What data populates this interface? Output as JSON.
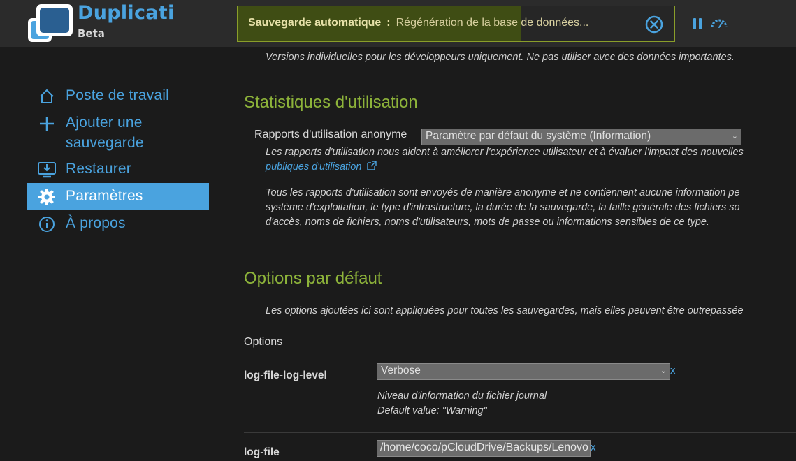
{
  "app": {
    "name": "Duplicati",
    "edition": "Beta"
  },
  "status": {
    "title": "Sauvegarde automatique",
    "separator": ":",
    "message": "Régénération de la base de données...",
    "progress": 0.65
  },
  "colors": {
    "accent": "#4aa3df",
    "heading": "#8db33a",
    "progress": "#3f4d14"
  },
  "sidebar": {
    "items": [
      {
        "label": "Poste de travail",
        "icon": "home-icon"
      },
      {
        "label": "Ajouter une sauvegarde",
        "icon": "plus-icon"
      },
      {
        "label": "Restaurer",
        "icon": "restore-icon"
      },
      {
        "label": "Paramètres",
        "icon": "gear-icon",
        "active": true
      },
      {
        "label": "À propos",
        "icon": "info-icon"
      }
    ]
  },
  "main": {
    "dev_note": "Versions individuelles pour les développeurs uniquement. Ne pas utiliser avec des données importantes.",
    "usage_stats": {
      "heading": "Statistiques d'utilisation",
      "label": "Rapports d'utilisation anonyme",
      "select_value": "Paramètre par défaut du système (Information)",
      "desc1": "Les rapports d'utilisation nous aident à améliorer l'expérience utilisateur et à évaluer l'impact des nouvelles",
      "link": "publiques d'utilisation",
      "desc2_l1": "Tous les rapports d'utilisation sont envoyés de manière anonyme et ne contiennent aucune information pe",
      "desc2_l2": "système d'exploitation, le type d'infrastructure, la durée de la sauvegarde, la taille générale des fichiers so",
      "desc2_l3": "d'accès, noms de fichiers, noms d'utilisateurs, mots de passe ou informations sensibles de ce type."
    },
    "default_options": {
      "heading": "Options par défaut",
      "desc": "Les options ajoutées ici sont appliquées pour toutes les sauvegardes, mais elles peuvent être outrepassée",
      "options_label": "Options",
      "option1": {
        "name": "log-file-log-level",
        "value": "Verbose",
        "remove": "x",
        "desc": "Niveau d'information du fichier journal",
        "default": "Default value: \"Warning\""
      },
      "option2": {
        "name": "log-file",
        "value": "/home/coco/pCloudDrive/Backups/Lenovo",
        "remove": "x"
      }
    }
  }
}
